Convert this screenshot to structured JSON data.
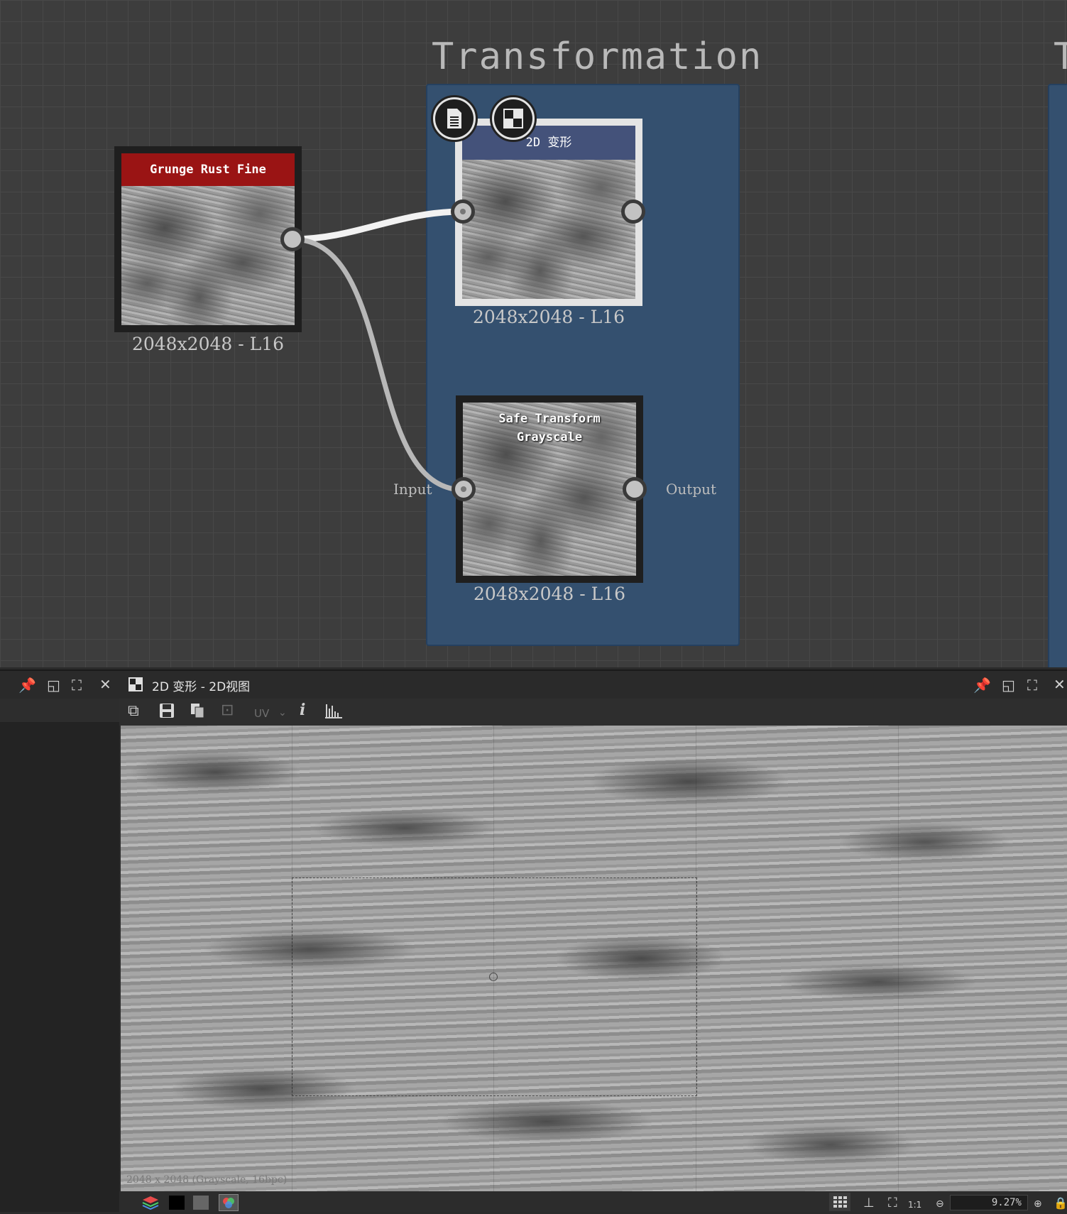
{
  "graph": {
    "frame_title": "Transformation",
    "frame2_title_partial": "T",
    "nodes": {
      "grunge": {
        "title": "Grunge Rust Fine",
        "resolution": "2048x2048 - L16",
        "header_color": "#9a1414"
      },
      "transform2d": {
        "title": "2D 变形",
        "resolution": "2048x2048 - L16",
        "header_color": "#44527a"
      },
      "safe": {
        "title": "Safe Transform Grayscale",
        "resolution": "2048x2048 - L16",
        "input_label": "Input",
        "output_label": "Output"
      }
    },
    "frame_color": "#34506f",
    "icons": {
      "doc": "document-icon",
      "checker": "checker-icon"
    }
  },
  "panel": {
    "title": "2D 变形 - 2D视图",
    "toolbar": {
      "uv_label": "UV",
      "info": "i"
    },
    "viewport_caption": "2048 x 2048 (Grayscale, 16bpc)",
    "zoom": "9.27%"
  }
}
